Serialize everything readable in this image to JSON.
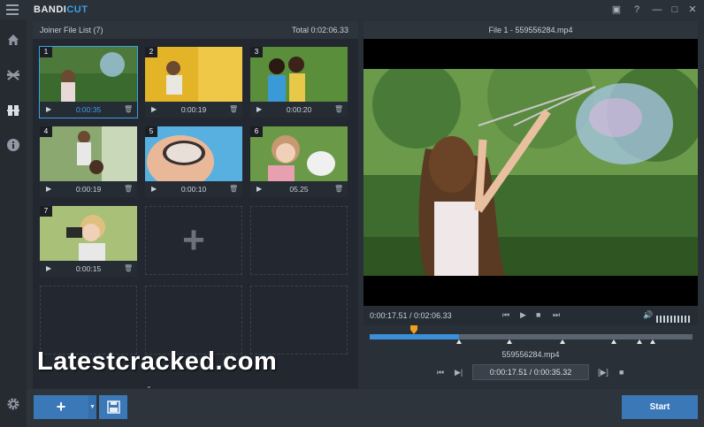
{
  "app": {
    "logo_main": "BANDI",
    "logo_accent": "CUT"
  },
  "window_buttons": {
    "folder": "▣",
    "help": "?",
    "minimize": "—",
    "maximize": "□",
    "close": "✕"
  },
  "joiner": {
    "title": "Joiner File List (7)",
    "total": "Total 0:02:06.33",
    "clips": [
      {
        "num": "1",
        "duration": "0:00:35"
      },
      {
        "num": "2",
        "duration": "0:00:19"
      },
      {
        "num": "3",
        "duration": "0:00:20"
      },
      {
        "num": "4",
        "duration": "0:00:19"
      },
      {
        "num": "5",
        "duration": "0:00:10"
      },
      {
        "num": "6",
        "duration": "05.25"
      },
      {
        "num": "7",
        "duration": "0:00:15"
      }
    ],
    "add_symbol": "+"
  },
  "watermark": "Latestcracked.com",
  "preview": {
    "file_title": "File 1 - 559556284.mp4",
    "time_readout": "0:00:17.51  /  0:02:06.33",
    "segment_name": "559556284.mp4",
    "segment_time": "0:00:17.51  /  0:00:35.32",
    "playhead_fraction": 0.135,
    "segment_fill_fraction": 0.277
  },
  "bottom": {
    "add_label": "+",
    "start_label": "Start"
  },
  "colors": {
    "accent": "#3aa0e8",
    "button": "#3a78b8",
    "playhead": "#f0a020"
  }
}
